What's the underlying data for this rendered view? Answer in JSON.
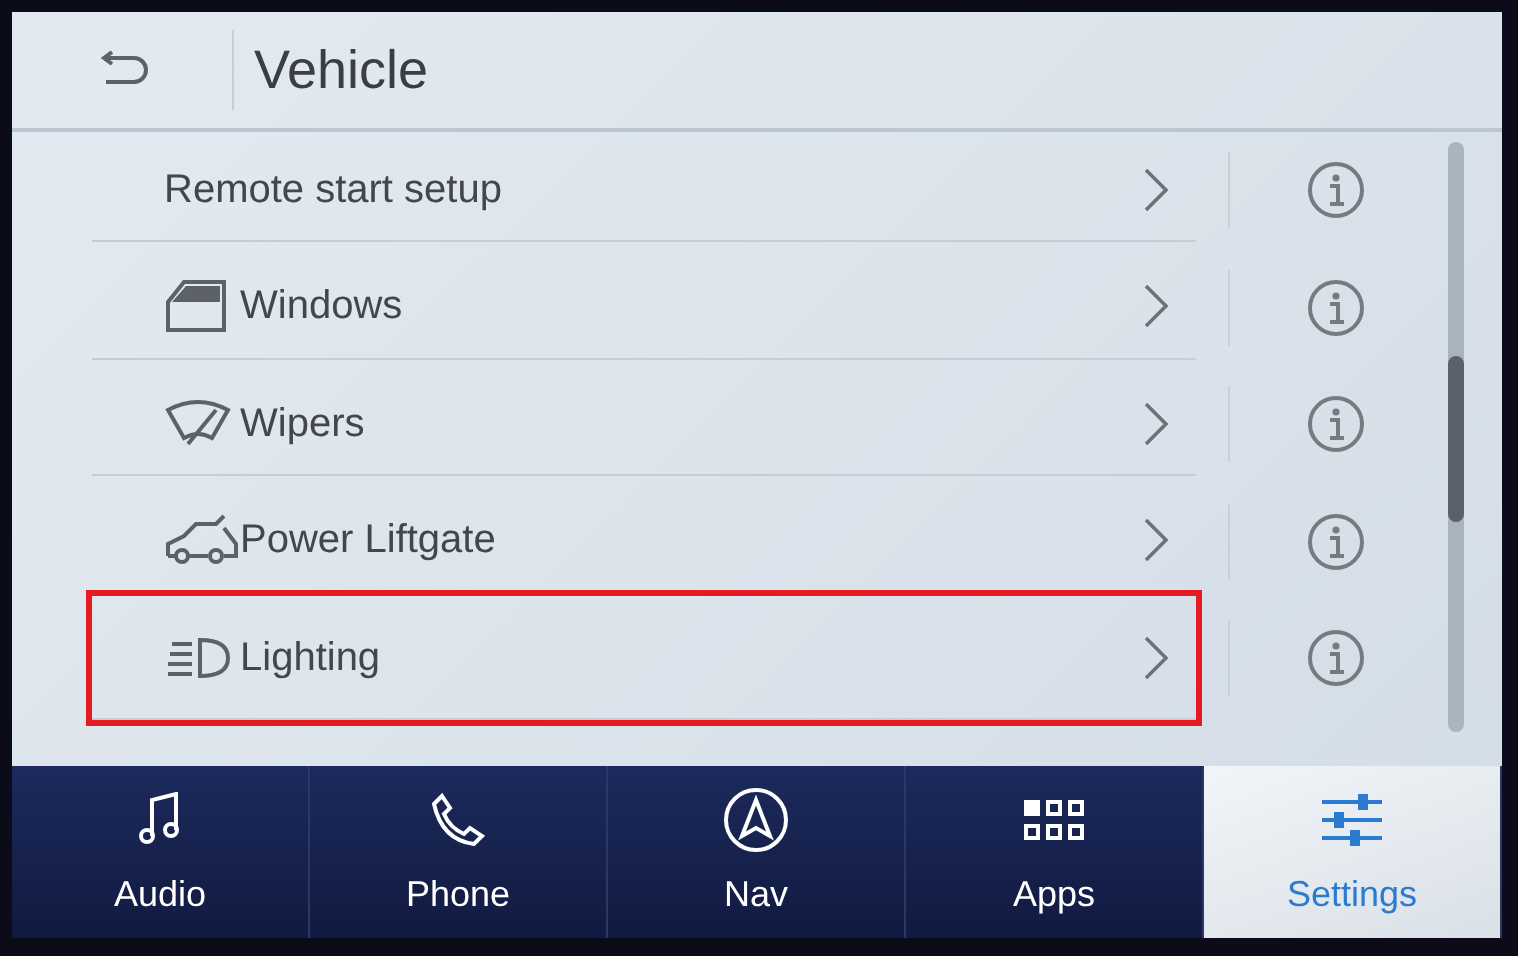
{
  "header": {
    "title": "Vehicle"
  },
  "items": [
    {
      "label": "Remote start setup",
      "kind": "plain",
      "highlighted": false
    },
    {
      "label": "Windows",
      "kind": "icon",
      "highlighted": false
    },
    {
      "label": "Wipers",
      "kind": "icon",
      "highlighted": false
    },
    {
      "label": "Power Liftgate",
      "kind": "icon",
      "highlighted": false
    },
    {
      "label": "Lighting",
      "kind": "icon",
      "highlighted": true
    }
  ],
  "tabs": [
    {
      "label": "Audio",
      "selected": false
    },
    {
      "label": "Phone",
      "selected": false
    },
    {
      "label": "Nav",
      "selected": false
    },
    {
      "label": "Apps",
      "selected": false
    },
    {
      "label": "Settings",
      "selected": true
    }
  ]
}
